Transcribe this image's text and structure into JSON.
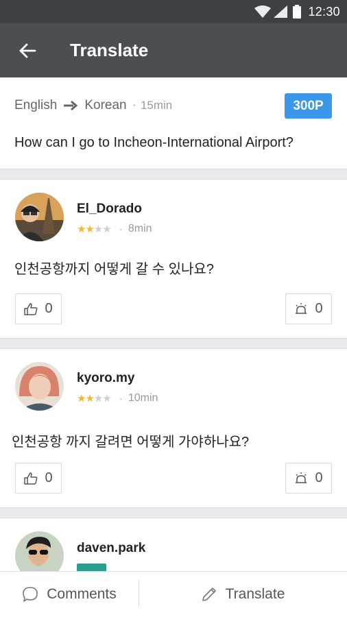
{
  "status_bar": {
    "time": "12:30"
  },
  "app_bar": {
    "title": "Translate"
  },
  "question": {
    "source_lang": "English",
    "target_lang": "Korean",
    "time_ago": "15min",
    "points": "300P",
    "text": "How can I go to Incheon-International Airport?"
  },
  "answers": [
    {
      "username": "El_Dorado",
      "rating": 2,
      "rating_max": 4,
      "time_ago": "8min",
      "text": "인천공항까지 어떻게 갈 수 있나요?",
      "likes": "0",
      "reports": "0"
    },
    {
      "username": "kyoro.my",
      "rating": 2,
      "rating_max": 4,
      "time_ago": "10min",
      "text": "인천공항 까지 갈려면 어떻게 가야하나요?",
      "likes": "0",
      "reports": "0"
    },
    {
      "username": "daven.park"
    }
  ],
  "bottom_bar": {
    "comments_label": "Comments",
    "translate_label": "Translate"
  },
  "colors": {
    "app_bar": "#4a4f54",
    "status_bar": "#3c4146",
    "points_badge": "#3b97ea",
    "star": "#f5b731"
  }
}
